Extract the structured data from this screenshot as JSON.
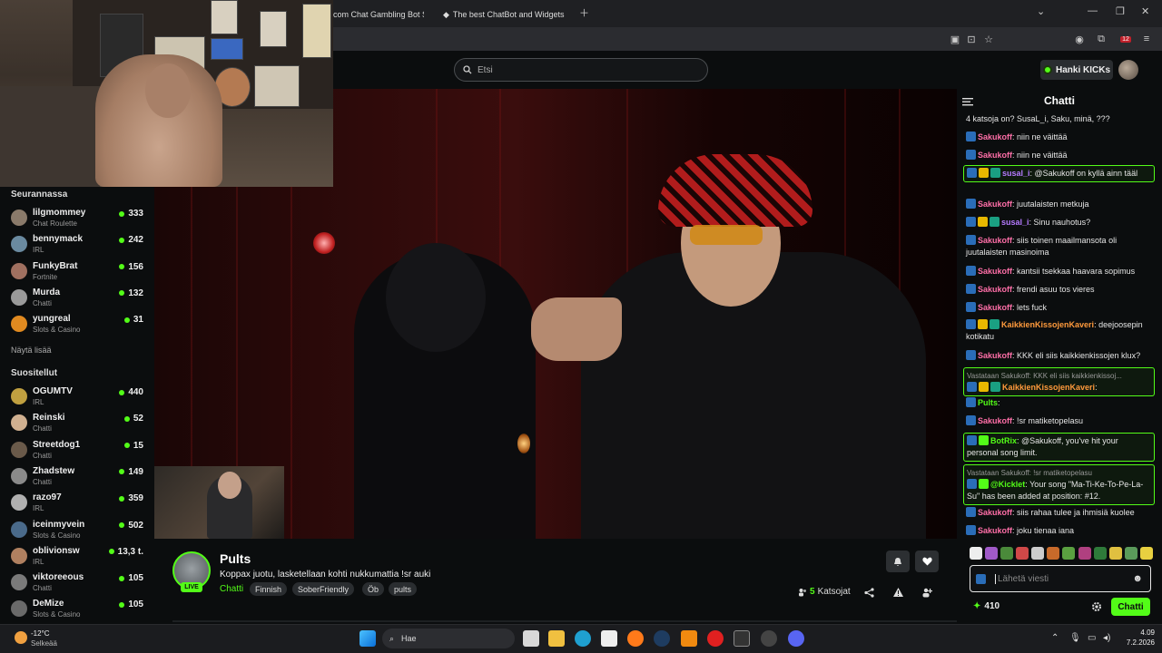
{
  "browser": {
    "tabs": [
      {
        "label": "com Chat Gambling Bot Se"
      },
      {
        "label": "The best ChatBot and Widgets"
      }
    ]
  },
  "header": {
    "search_placeholder": "Etsi",
    "get_kicks_label": "Hanki KICKs"
  },
  "sidebar": {
    "following_title": "Seurannassa",
    "following": [
      {
        "name": "lilgmommey",
        "category": "Chat Roulette",
        "viewers": "333"
      },
      {
        "name": "bennymack",
        "category": "IRL",
        "viewers": "242"
      },
      {
        "name": "FunkyBrat",
        "category": "Fortnite",
        "viewers": "156"
      },
      {
        "name": "Murda",
        "category": "Chatti",
        "viewers": "132"
      },
      {
        "name": "yungreal",
        "category": "Slots & Casino",
        "viewers": "31"
      }
    ],
    "show_more": "Näytä lisää",
    "recommended_title": "Suositellut",
    "recommended": [
      {
        "name": "OGUMTV",
        "category": "IRL",
        "viewers": "440"
      },
      {
        "name": "Reinski",
        "category": "Chatti",
        "viewers": "52"
      },
      {
        "name": "Streetdog1",
        "category": "Chatti",
        "viewers": "15"
      },
      {
        "name": "Zhadstew",
        "category": "Chatti",
        "viewers": "149"
      },
      {
        "name": "razo97",
        "category": "IRL",
        "viewers": "359"
      },
      {
        "name": "iceinmyvein",
        "category": "Slots & Casino",
        "viewers": "502"
      },
      {
        "name": "oblivionsw",
        "category": "IRL",
        "viewers": "13,3 t."
      },
      {
        "name": "viktoreeous",
        "category": "Chatti",
        "viewers": "105"
      },
      {
        "name": "DeMize",
        "category": "Slots & Casino",
        "viewers": "105"
      }
    ]
  },
  "stream": {
    "streamer": "Pults",
    "live_label": "LIVE",
    "title": "Koppax juotu, lasketellaan kohti nukkumattia !sr auki",
    "category": "Chatti",
    "tags": [
      "Finnish",
      "SoberFriendly",
      "Öb",
      "pults"
    ],
    "viewer_count": "5",
    "viewer_label": "Katsojat"
  },
  "chat": {
    "title": "Chatti",
    "messages": [
      {
        "user": "",
        "text": "4 katsoja on? SusaL_i, Saku, minä, ???",
        "color": "#e6e6e6"
      },
      {
        "user": "Sakukoff",
        "text": ": niin ne väittää",
        "color": "#ff6fa8"
      },
      {
        "user": "Sakukoff",
        "text": ": niin ne väittää",
        "color": "#ff6fa8"
      },
      {
        "user": "susal_i",
        "text": ": @Sakukoff on kyllä ainn tääl",
        "color": "#b57bff"
      },
      {
        "user": "Sakukoff",
        "text": ": juutalaisten metkuja",
        "color": "#ff6fa8"
      },
      {
        "user": "susal_i",
        "text": ": Sinu nauhotus?",
        "color": "#b57bff"
      },
      {
        "user": "Sakukoff",
        "text": ": siis toinen maailmansota oli juutalaisten masinoima",
        "color": "#ff6fa8"
      },
      {
        "user": "Sakukoff",
        "text": ": kantsii tsekkaa haavara sopimus",
        "color": "#ff6fa8"
      },
      {
        "user": "Sakukoff",
        "text": ": frendi asuu tos vieres",
        "color": "#ff6fa8"
      },
      {
        "user": "Sakukoff",
        "text": ": lets fuck",
        "color": "#ff6fa8"
      },
      {
        "user": "KaikkienKissojenKaveri",
        "text": ": deejoosepin kotikatu",
        "color": "#ff9a3c"
      },
      {
        "user": "Sakukoff",
        "text": ": KKK eli siis kaikkienkissojen klux?",
        "color": "#ff6fa8"
      },
      {
        "reply": "Vastataan Sakukoff: KKK eli siis kaikkienkissoj...",
        "user": "KaikkienKissojenKaveri",
        "text": ":",
        "color": "#ff9a3c"
      },
      {
        "user": "Pults",
        "text": ":",
        "color": "#53fc18"
      },
      {
        "user": "Sakukoff",
        "text": ": !sr matiketopelasu",
        "color": "#ff6fa8"
      },
      {
        "user": "BotRix",
        "text": ": @Sakukoff, you've hit your personal song limit.",
        "color": "#53fc18"
      },
      {
        "reply": "Vastataan Sakukoff: !sr matiketopelasu",
        "user": "@Kicklet",
        "text": ": Your song \"Ma-Ti-Ke-To-Pe-La-Su\" has been added at position: #12.",
        "color": "#53fc18"
      },
      {
        "user": "Sakukoff",
        "text": ": siis rahaa tulee ja ihmisiä kuolee",
        "color": "#ff6fa8"
      },
      {
        "user": "Sakukoff",
        "text": ": joku tienaa iana",
        "color": "#ff6fa8"
      }
    ],
    "input_placeholder": "Lähetä viesti",
    "points": "410",
    "send_label": "Chatti"
  },
  "taskbar": {
    "temperature": "-12°C",
    "condition": "Selkeää",
    "search_label": "Hae",
    "time": "4.09",
    "date": "7.2.2026"
  }
}
